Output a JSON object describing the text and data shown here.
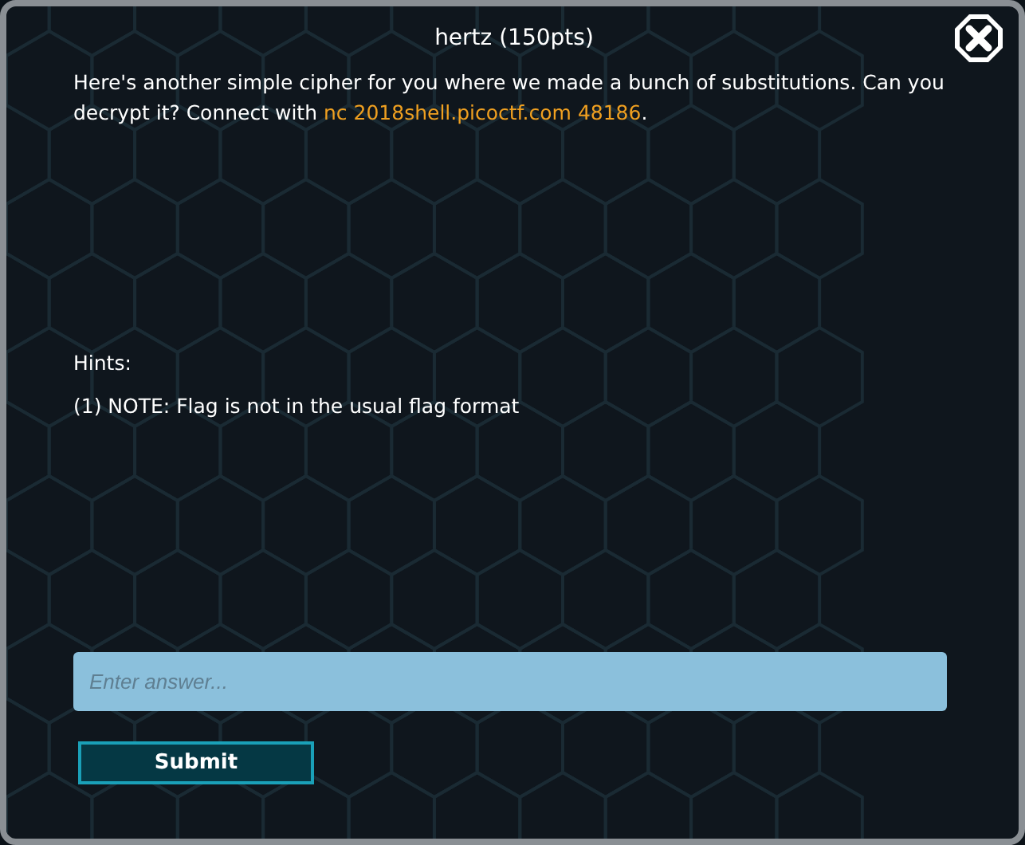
{
  "title": "hertz (150pts)",
  "description": {
    "text": "Here's another simple cipher for you where we made a bunch of substitutions. Can you decrypt it? Connect with ",
    "link": "nc 2018shell.picoctf.com 48186",
    "after": "."
  },
  "hints_label": "Hints:",
  "hints": [
    "(1) NOTE: Flag is not in the usual flag format"
  ],
  "answer": {
    "placeholder": "Enter answer..."
  },
  "submit": "Submit"
}
